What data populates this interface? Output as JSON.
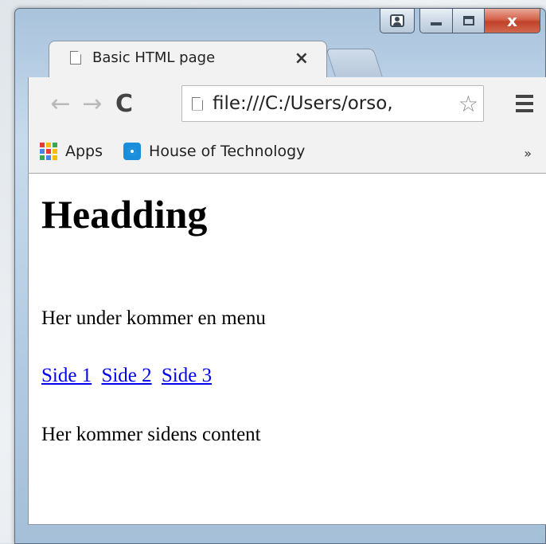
{
  "tab": {
    "title": "Basic HTML page",
    "close_glyph": "×"
  },
  "toolbar": {
    "back_glyph": "←",
    "forward_glyph": "→",
    "reload_glyph": "C",
    "url": "file:///C:/Users/orso,",
    "star_glyph": "☆"
  },
  "bookmarks": {
    "apps_label": "Apps",
    "items": [
      {
        "label": "House of Technology"
      }
    ],
    "more_glyph": "»"
  },
  "window": {
    "close_glyph": "x"
  },
  "page": {
    "heading": "Headding",
    "intro": "Her under kommer en menu",
    "links": [
      "Side 1",
      "Side 2",
      "Side 3"
    ],
    "body": "Her kommer sidens content"
  },
  "colors": {
    "link": "#0000ee",
    "close_button": "#c7442d",
    "apps": [
      "#e53935",
      "#fbbc05",
      "#34a853",
      "#4285f4",
      "#e53935",
      "#fbbc05",
      "#34a853",
      "#4285f4",
      "#fbbc05"
    ]
  }
}
